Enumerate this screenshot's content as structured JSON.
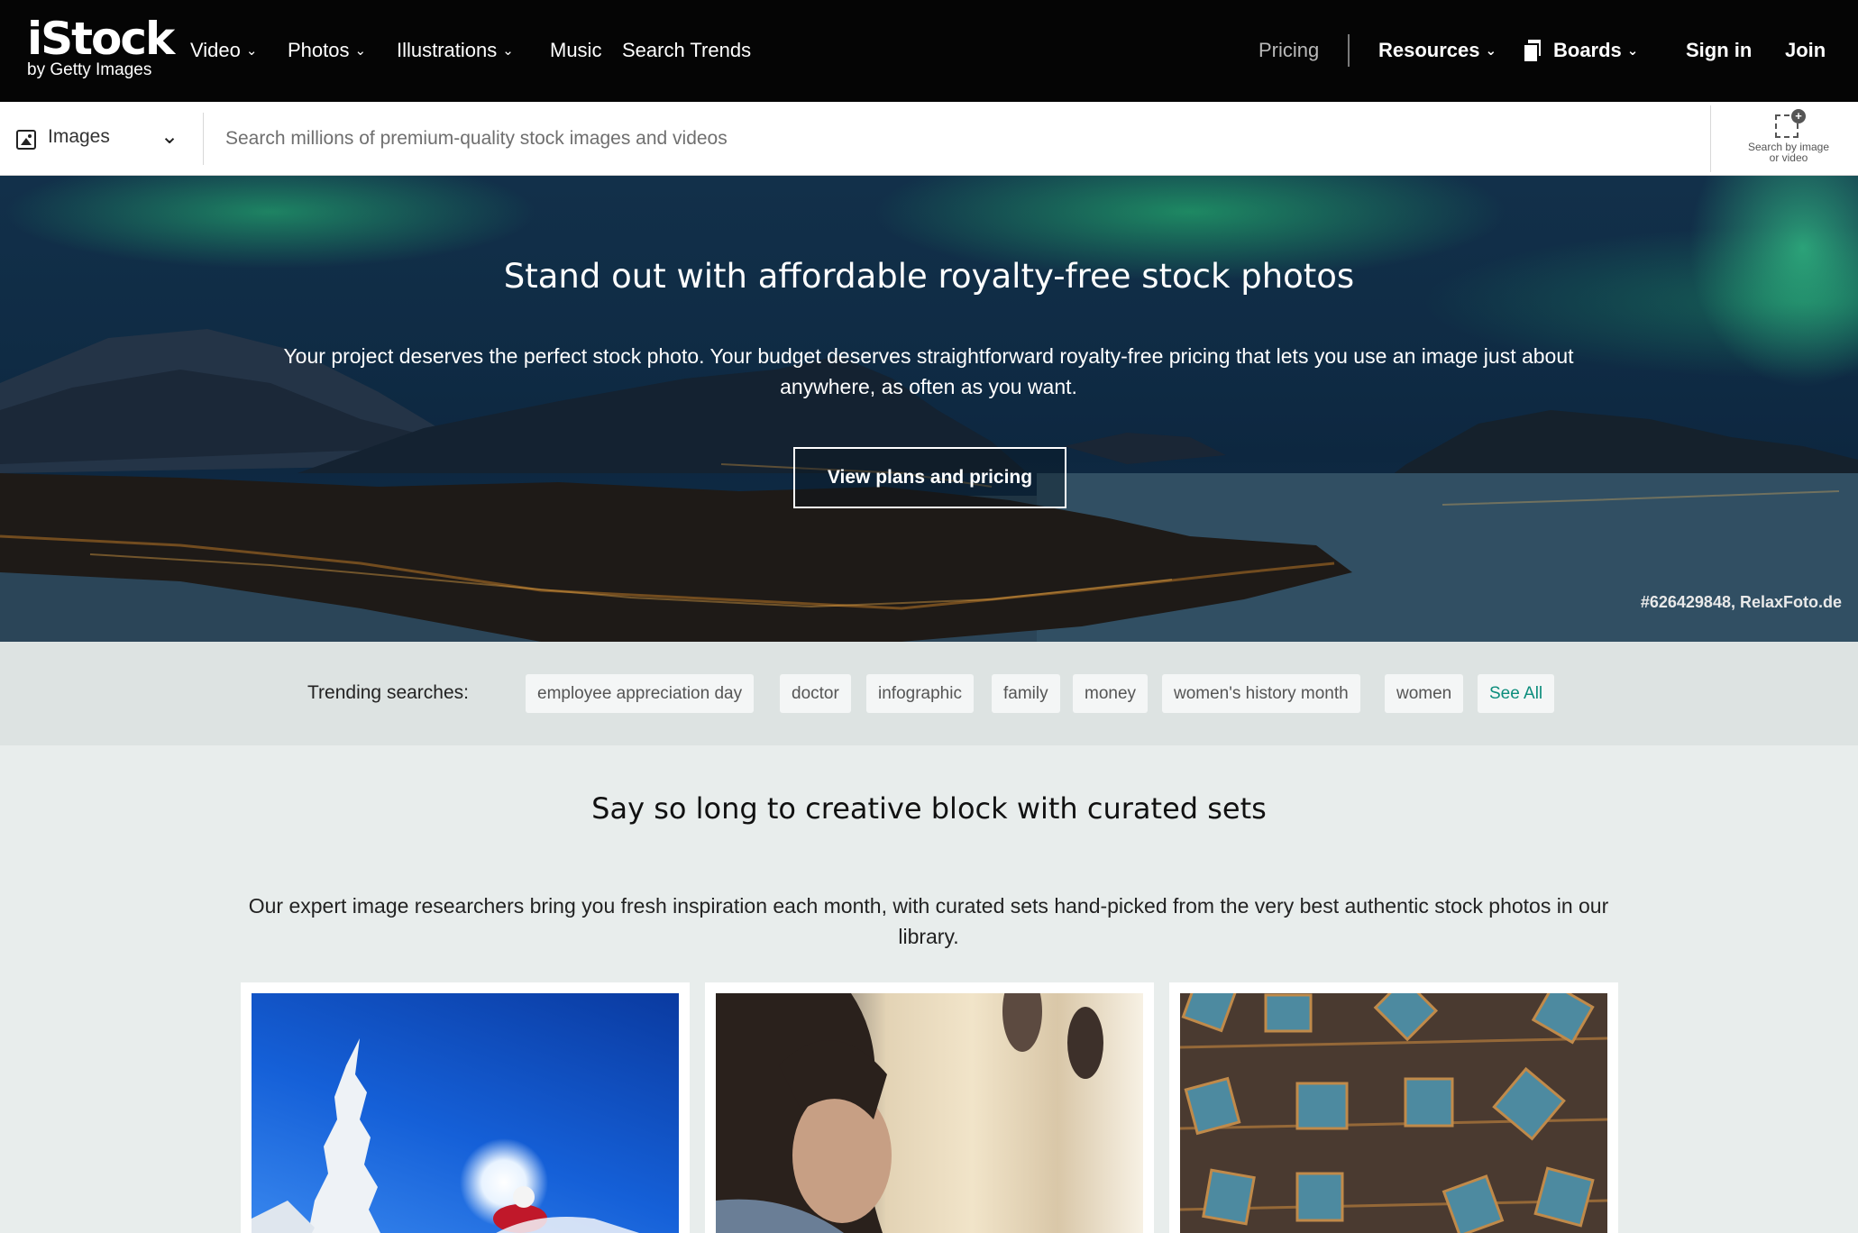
{
  "nav": {
    "logo_main": "iStock",
    "logo_sub": "by Getty Images",
    "video": "Video",
    "photos": "Photos",
    "illustrations": "Illustrations",
    "music": "Music",
    "search_trends": "Search Trends",
    "pricing": "Pricing",
    "resources": "Resources",
    "boards": "Boards",
    "sign_in": "Sign in",
    "join": "Join"
  },
  "search": {
    "media_type": "Images",
    "placeholder": "Search millions of premium-quality stock images and videos",
    "image_search_label_1": "Search by image",
    "image_search_label_2": "or video"
  },
  "hero": {
    "title": "Stand out with affordable royalty-free stock photos",
    "subtitle": "Your project deserves the perfect stock photo. Your budget deserves straightforward royalty-free pricing that lets you use an image just about anywhere, as often as you want.",
    "button": "View plans and pricing",
    "credit": "#626429848, RelaxFoto.de"
  },
  "trending": {
    "label": "Trending searches:",
    "chips": [
      "employee appreciation day",
      "doctor",
      "infographic",
      "family",
      "money",
      "women's history month",
      "women"
    ],
    "see_all": "See All"
  },
  "curated": {
    "title": "Say so long to creative block with curated sets",
    "subtitle": "Our expert image researchers bring you fresh inspiration each month, with curated sets hand-picked from the very best authentic stock photos in our library."
  },
  "colors": {
    "nav_bg": "#050505",
    "accent_teal": "#0c8d7c",
    "page_bg": "#e8edec",
    "trending_bg": "#dde3e2"
  }
}
